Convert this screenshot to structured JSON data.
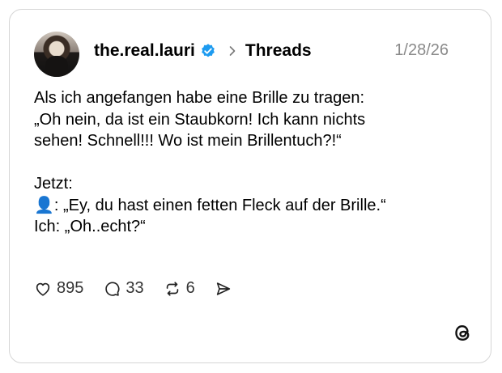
{
  "post": {
    "username": "the.real.lauri",
    "channel": "Threads",
    "date": "1/28/26",
    "lines": [
      "Als ich angefangen habe eine Brille zu tragen:",
      "„Oh nein, da ist ein Staubkorn! Ich kann nichts",
      "sehen! Schnell!!! Wo ist mein Brillentuch?!“",
      "Jetzt:",
      "👤: „Ey, du hast einen fetten Fleck auf der Brille.“",
      "Ich: „Oh..echt?“"
    ]
  },
  "actions": {
    "likes": "895",
    "replies": "33",
    "reposts": "6"
  },
  "icons": {
    "avatar": "profile-photo",
    "verified": "verified-badge-icon",
    "chevron": "chevron-right-icon",
    "like": "heart-icon",
    "reply": "speech-bubble-icon",
    "repost": "repost-icon",
    "share": "send-icon",
    "logo": "threads-logo-icon"
  },
  "colors": {
    "verified": "#1d9bf0",
    "date": "#8a8a8a",
    "border": "#d5d5d5"
  }
}
